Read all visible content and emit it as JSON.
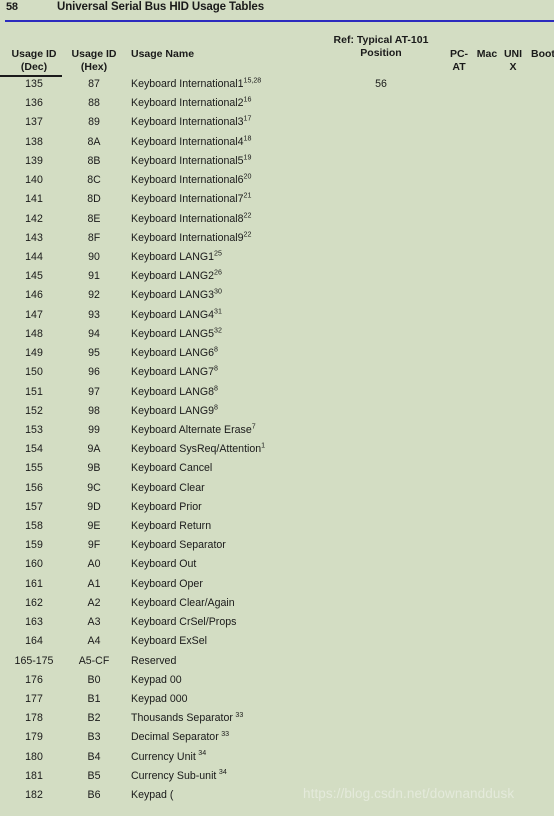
{
  "page": {
    "folio": "58",
    "doc_title": "Universal Serial Bus HID Usage Tables",
    "rule_color": "#2b2bbe",
    "background_color": "#d3ddc3"
  },
  "table": {
    "headers": {
      "usage_id_dec_l1": "Usage ID",
      "usage_id_dec_l2": "(Dec)",
      "usage_id_hex_l1": "Usage ID",
      "usage_id_hex_l2": "(Hex)",
      "usage_name": "Usage Name",
      "position_l1": "Ref: Typical AT-101",
      "position_l2": "Position",
      "pc_at_l1": "PC-",
      "pc_at_l2": "AT",
      "mac": "Mac",
      "unix_l1": "UNI",
      "unix_l2": "X",
      "boot": "Boot"
    },
    "rows": [
      {
        "dec": "135",
        "hex": "87",
        "name": "Keyboard International1",
        "sup": "15,28",
        "sup_space": false,
        "pos": "56"
      },
      {
        "dec": "136",
        "hex": "88",
        "name": "Keyboard International2",
        "sup": "16",
        "sup_space": false,
        "pos": ""
      },
      {
        "dec": "137",
        "hex": "89",
        "name": "Keyboard International3",
        "sup": "17",
        "sup_space": false,
        "pos": ""
      },
      {
        "dec": "138",
        "hex": "8A",
        "name": "Keyboard International4",
        "sup": "18",
        "sup_space": false,
        "pos": ""
      },
      {
        "dec": "139",
        "hex": "8B",
        "name": "Keyboard International5",
        "sup": "19",
        "sup_space": false,
        "pos": ""
      },
      {
        "dec": "140",
        "hex": "8C",
        "name": "Keyboard International6",
        "sup": "20",
        "sup_space": false,
        "pos": ""
      },
      {
        "dec": "141",
        "hex": "8D",
        "name": "Keyboard International7",
        "sup": "21",
        "sup_space": false,
        "pos": ""
      },
      {
        "dec": "142",
        "hex": "8E",
        "name": "Keyboard International8",
        "sup": "22",
        "sup_space": false,
        "pos": ""
      },
      {
        "dec": "143",
        "hex": "8F",
        "name": "Keyboard International9",
        "sup": "22",
        "sup_space": false,
        "pos": ""
      },
      {
        "dec": "144",
        "hex": "90",
        "name": "Keyboard LANG1",
        "sup": "25",
        "sup_space": false,
        "pos": ""
      },
      {
        "dec": "145",
        "hex": "91",
        "name": "Keyboard LANG2",
        "sup": "26",
        "sup_space": false,
        "pos": ""
      },
      {
        "dec": "146",
        "hex": "92",
        "name": "Keyboard LANG3",
        "sup": "30",
        "sup_space": false,
        "pos": ""
      },
      {
        "dec": "147",
        "hex": "93",
        "name": "Keyboard LANG4",
        "sup": "31",
        "sup_space": false,
        "pos": ""
      },
      {
        "dec": "148",
        "hex": "94",
        "name": "Keyboard LANG5",
        "sup": "32",
        "sup_space": false,
        "pos": ""
      },
      {
        "dec": "149",
        "hex": "95",
        "name": "Keyboard LANG6",
        "sup": "8",
        "sup_space": false,
        "pos": ""
      },
      {
        "dec": "150",
        "hex": "96",
        "name": "Keyboard LANG7",
        "sup": "8",
        "sup_space": false,
        "pos": ""
      },
      {
        "dec": "151",
        "hex": "97",
        "name": "Keyboard LANG8",
        "sup": "8",
        "sup_space": false,
        "pos": ""
      },
      {
        "dec": "152",
        "hex": "98",
        "name": "Keyboard LANG9",
        "sup": "8",
        "sup_space": false,
        "pos": ""
      },
      {
        "dec": "153",
        "hex": "99",
        "name": "Keyboard Alternate Erase",
        "sup": "7",
        "sup_space": false,
        "pos": ""
      },
      {
        "dec": "154",
        "hex": "9A",
        "name": "Keyboard SysReq/Attention",
        "sup": "1",
        "sup_space": false,
        "pos": ""
      },
      {
        "dec": "155",
        "hex": "9B",
        "name": "Keyboard Cancel",
        "sup": "",
        "sup_space": false,
        "pos": ""
      },
      {
        "dec": "156",
        "hex": "9C",
        "name": "Keyboard Clear",
        "sup": "",
        "sup_space": false,
        "pos": ""
      },
      {
        "dec": "157",
        "hex": "9D",
        "name": "Keyboard Prior",
        "sup": "",
        "sup_space": false,
        "pos": ""
      },
      {
        "dec": "158",
        "hex": "9E",
        "name": "Keyboard Return",
        "sup": "",
        "sup_space": false,
        "pos": ""
      },
      {
        "dec": "159",
        "hex": "9F",
        "name": "Keyboard Separator",
        "sup": "",
        "sup_space": false,
        "pos": ""
      },
      {
        "dec": "160",
        "hex": "A0",
        "name": "Keyboard Out",
        "sup": "",
        "sup_space": false,
        "pos": ""
      },
      {
        "dec": "161",
        "hex": "A1",
        "name": "Keyboard Oper",
        "sup": "",
        "sup_space": false,
        "pos": ""
      },
      {
        "dec": "162",
        "hex": "A2",
        "name": "Keyboard Clear/Again",
        "sup": "",
        "sup_space": false,
        "pos": ""
      },
      {
        "dec": "163",
        "hex": "A3",
        "name": "Keyboard CrSel/Props",
        "sup": "",
        "sup_space": false,
        "pos": ""
      },
      {
        "dec": "164",
        "hex": "A4",
        "name": "Keyboard ExSel",
        "sup": "",
        "sup_space": false,
        "pos": ""
      },
      {
        "dec": "165-175",
        "hex": "A5-CF",
        "name": "Reserved",
        "sup": "",
        "sup_space": false,
        "pos": ""
      },
      {
        "dec": "176",
        "hex": "B0",
        "name": "Keypad 00",
        "sup": "",
        "sup_space": false,
        "pos": ""
      },
      {
        "dec": "177",
        "hex": "B1",
        "name": "Keypad 000",
        "sup": "",
        "sup_space": false,
        "pos": ""
      },
      {
        "dec": "178",
        "hex": "B2",
        "name": "Thousands Separator",
        "sup": "33",
        "sup_space": true,
        "pos": ""
      },
      {
        "dec": "179",
        "hex": "B3",
        "name": "Decimal Separator",
        "sup": "33",
        "sup_space": true,
        "pos": ""
      },
      {
        "dec": "180",
        "hex": "B4",
        "name": "Currency Unit",
        "sup": "34",
        "sup_space": true,
        "pos": ""
      },
      {
        "dec": "181",
        "hex": "B5",
        "name": "Currency Sub-unit",
        "sup": "34",
        "sup_space": true,
        "pos": ""
      },
      {
        "dec": "182",
        "hex": "B6",
        "name": "Keypad (",
        "sup": "",
        "sup_space": false,
        "pos": ""
      }
    ]
  },
  "watermark": {
    "text": "https://blog.csdn.net/downanddusk"
  }
}
